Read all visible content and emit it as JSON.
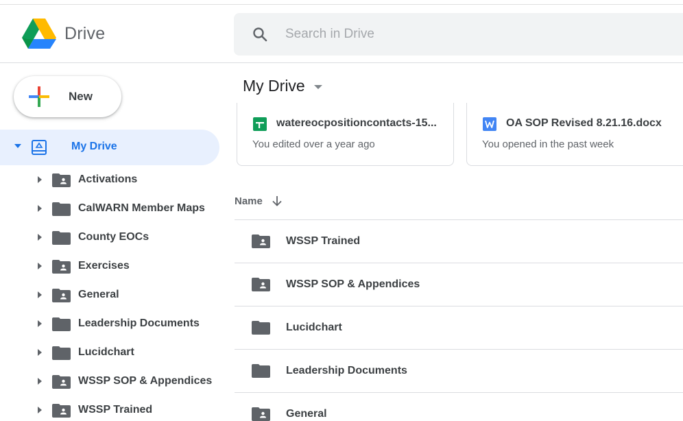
{
  "app": {
    "title": "Drive"
  },
  "search": {
    "placeholder": "Search in Drive",
    "value": ""
  },
  "new_button": {
    "label": "New"
  },
  "sidebar": {
    "root": {
      "label": "My Drive",
      "icon": "my-drive-icon",
      "expanded": true
    },
    "items": [
      {
        "label": "Activations",
        "icon": "shared-folder-icon"
      },
      {
        "label": "CalWARN Member Maps",
        "icon": "folder-icon"
      },
      {
        "label": "County EOCs",
        "icon": "folder-icon"
      },
      {
        "label": "Exercises",
        "icon": "shared-folder-icon"
      },
      {
        "label": "General",
        "icon": "shared-folder-icon"
      },
      {
        "label": "Leadership Documents",
        "icon": "folder-icon"
      },
      {
        "label": "Lucidchart",
        "icon": "folder-icon"
      },
      {
        "label": "WSSP SOP & Appendices",
        "icon": "shared-folder-icon"
      },
      {
        "label": "WSSP Trained",
        "icon": "shared-folder-icon"
      }
    ]
  },
  "main": {
    "title": "My Drive",
    "quick_access": [
      {
        "name": "watereocpositioncontacts-15...",
        "subtitle": "You edited over a year ago",
        "type": "google-sheets-icon",
        "color": "#0f9d58"
      },
      {
        "name": "OA SOP Revised 8.21.16.docx",
        "subtitle": "You opened in the past week",
        "type": "word-doc-icon",
        "color": "#4285f4"
      }
    ],
    "sort": {
      "column": "Name",
      "direction": "descending"
    },
    "files": [
      {
        "name": "WSSP Trained",
        "icon": "shared-folder-icon"
      },
      {
        "name": "WSSP SOP & Appendices",
        "icon": "shared-folder-icon"
      },
      {
        "name": "Lucidchart",
        "icon": "folder-icon"
      },
      {
        "name": "Leadership Documents",
        "icon": "folder-icon"
      },
      {
        "name": "General",
        "icon": "shared-folder-icon"
      }
    ]
  },
  "colors": {
    "accent": "#1a73e8",
    "selected_bg": "#e8f0fe",
    "folder": "#5f6368",
    "search_bg": "#f1f3f4"
  }
}
